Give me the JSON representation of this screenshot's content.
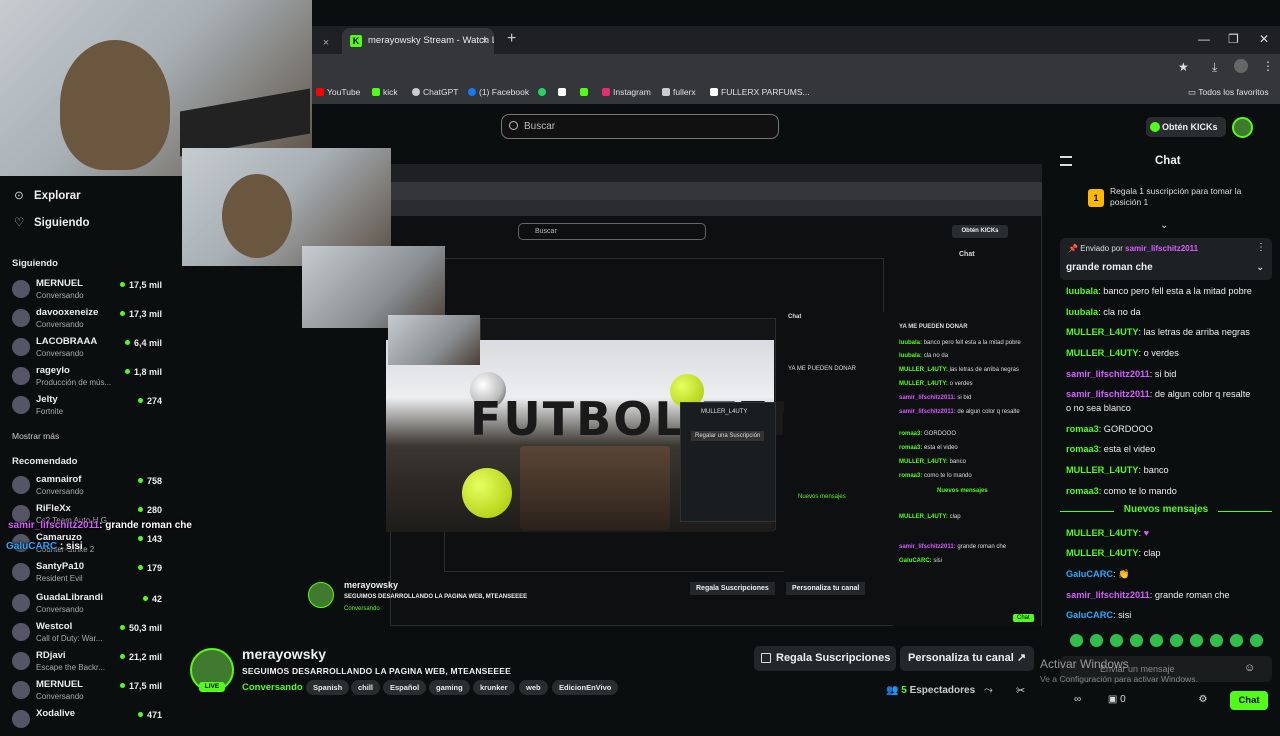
{
  "browser": {
    "tab_title": "merayowsky Stream - Watch Li",
    "tab_close": "×",
    "tab_new": "+",
    "window": {
      "minimize": "—",
      "maximize": "❐",
      "close": "✕"
    },
    "bookmarks": [
      {
        "label": "YouTube",
        "color": "#ff0000"
      },
      {
        "label": "kick",
        "color": "#53fc18"
      },
      {
        "label": "ChatGPT",
        "color": "#cccccc"
      },
      {
        "label": "(1) Facebook",
        "color": "#1877f2"
      },
      {
        "label": "",
        "color": "#25d366"
      },
      {
        "label": "",
        "color": "#ffffff"
      },
      {
        "label": "Instagram",
        "color": "#e1306c"
      },
      {
        "label": "fullerx",
        "color": "#cccccc"
      },
      {
        "label": "FULLERX PARFUMS...",
        "color": "#ffffff"
      }
    ],
    "all_bookmarks": "Todos los favoritos"
  },
  "header": {
    "search_placeholder": "Buscar",
    "kicks_button": "Obtén KICKs"
  },
  "sidebar": {
    "explore": "Explorar",
    "following_nav": "Siguiendo",
    "following_header": "Siguiendo",
    "following": [
      {
        "name": "MERNUEL",
        "category": "Conversando",
        "viewers": "17,5 mil"
      },
      {
        "name": "davooxeneize",
        "category": "Conversando",
        "viewers": "17,3 mil"
      },
      {
        "name": "LACOBRAAA",
        "category": "Conversando",
        "viewers": "6,4 mil"
      },
      {
        "name": "rageylo",
        "category": "Producción de mús...",
        "viewers": "1,8 mil"
      },
      {
        "name": "Jelty",
        "category": "Fortnite",
        "viewers": "274"
      }
    ],
    "show_more": "Mostrar más",
    "recommended_header": "Recomendado",
    "recommended": [
      {
        "name": "camnairof",
        "category": "Conversando",
        "viewers": "758"
      },
      {
        "name": "RiFleXx",
        "category": "Cs2 Team Auto-H G...",
        "viewers": "280"
      },
      {
        "name": "Camaruzo",
        "category": "Counter-Strike 2",
        "viewers": "143"
      },
      {
        "name": "SantyPa10",
        "category": "Resident Evil",
        "viewers": "179"
      },
      {
        "name": "GuadaLibrandi",
        "category": "Conversando",
        "viewers": "42"
      },
      {
        "name": "Westcol",
        "category": "Call of Duty: War...",
        "viewers": "50,3 mil"
      },
      {
        "name": "RDjavi",
        "category": "Escape the Backr...",
        "viewers": "21,2 mil"
      },
      {
        "name": "MERNUEL",
        "category": "Conversando",
        "viewers": "17,5 mil"
      },
      {
        "name": "Xodalive",
        "category": "",
        "viewers": "471"
      }
    ]
  },
  "stream": {
    "live_badge": "LIVE",
    "streamer": "merayowsky",
    "title": "SEGUIMOS DESARROLLANDO LA PAGINA WEB, MTEANSEEEE",
    "category": "Conversando",
    "tags": [
      "Spanish",
      "chill",
      "Español",
      "gaming",
      "krunker",
      "web",
      "EdicionEnVivo"
    ],
    "gift_button": "Regala Suscripciones",
    "customize_button": "Personaliza tu canal",
    "viewers_count": "5",
    "viewers_label": "Espectadores",
    "video_title": "FUTBOL TENIS"
  },
  "chat": {
    "title": "Chat",
    "gift_banner": "Regala 1 suscripción para tomar la posición 1",
    "gift_rank": "1",
    "pinned_by_label": "Enviado por",
    "pinned_by_user": "samir_lifschitz2011",
    "pinned_message": "grande roman che",
    "messages_before": [
      {
        "user": "luubala",
        "text": "banco pero fell esta a la mitad pobre",
        "color": "g"
      },
      {
        "user": "luubala",
        "text": "cla no da",
        "color": "g"
      },
      {
        "user": "MULLER_L4UTY",
        "text": "las letras de arriba negras",
        "color": "g"
      },
      {
        "user": "MULLER_L4UTY",
        "text": "o verdes",
        "color": "g"
      },
      {
        "user": "samir_lifschitz2011",
        "text": "si bid",
        "color": "p"
      },
      {
        "user": "samir_lifschitz2011",
        "text": "de algun color q resalte",
        "color": "p"
      },
      {
        "user": "",
        "text": "o no sea blanco",
        "color": "g"
      },
      {
        "user": "romaa3",
        "text": "GORDOOO",
        "color": "g"
      },
      {
        "user": "romaa3",
        "text": "esta el video",
        "color": "g"
      },
      {
        "user": "MULLER_L4UTY",
        "text": "banco",
        "color": "g"
      },
      {
        "user": "romaa3",
        "text": "como te lo mando",
        "color": "g"
      }
    ],
    "new_messages": "Nuevos mensajes",
    "messages_after": [
      {
        "user": "MULLER_L4UTY",
        "text": "",
        "color": "g"
      },
      {
        "user": "MULLER_L4UTY",
        "text": "clap",
        "color": "g"
      },
      {
        "user": "GaluCARC",
        "text": "",
        "color": "b"
      },
      {
        "user": "samir_lifschitz2011",
        "text": "grande roman che",
        "color": "p"
      },
      {
        "user": "GaluCARC",
        "text": "sisi",
        "color": "b"
      }
    ],
    "input_placeholder": "Enviar un mensaje",
    "send_button": "Chat",
    "kicks_count": "0"
  },
  "windows_watermark": {
    "line1": "Activar Windows",
    "line2": "Ve a Configuración para activar Windows."
  },
  "overlay_chat": [
    {
      "user": "samir_lifschitz2011",
      "text": "grande roman che",
      "color": "p"
    },
    {
      "user": "GaluCARC",
      "text": "sisi",
      "color": "b"
    }
  ],
  "nested": {
    "search_placeholder": "Buscar",
    "kicks_button": "Obtén KICKs",
    "chat_title": "Chat",
    "pinned": "YA ME PUEDEN DONAR",
    "new_messages": "Nuevos mensajes",
    "card_name": "MULLER_L4UTY",
    "gift_sub": "Regalar una Suscripción"
  },
  "colors": {
    "accent": "#53fc18",
    "background": "#0b0e0f",
    "panel": "#24272a"
  }
}
